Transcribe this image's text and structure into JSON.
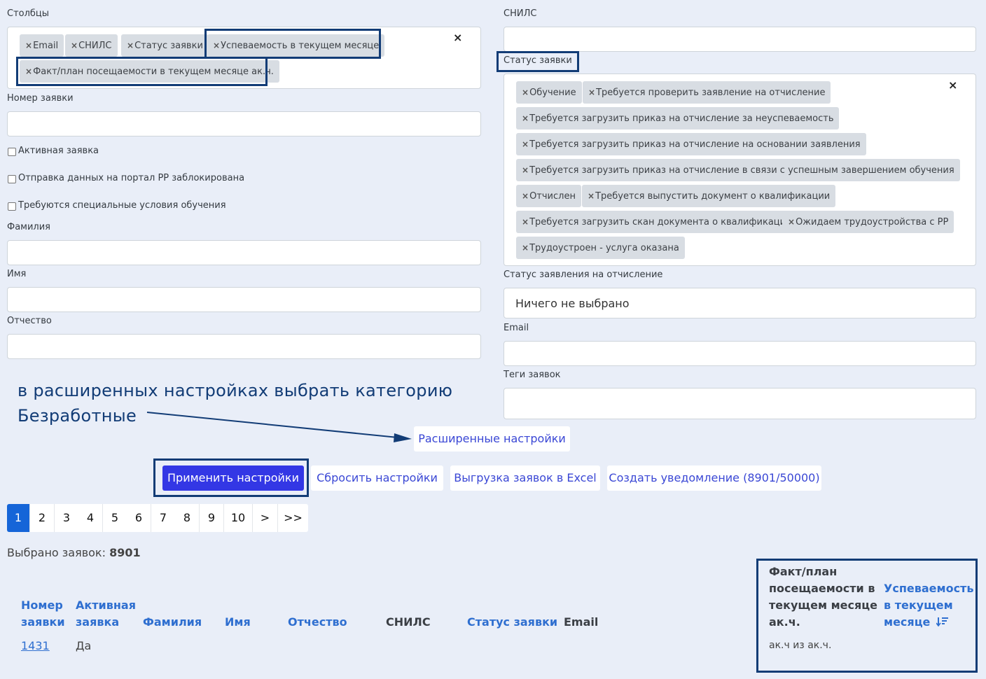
{
  "left": {
    "columns_label": "Столбцы",
    "column_chips": [
      "Email",
      "СНИЛС",
      "Статус заявки",
      "Успеваемость в текущем месяце",
      "Факт/план посещаемости в текущем месяце ак.ч."
    ],
    "clear_symbol": "×",
    "chip_x": "×",
    "order_no_label": "Номер заявки",
    "cb_active": "Активная заявка",
    "cb_blocked": "Отправка данных на портал РР заблокирована",
    "cb_special": "Требуются специальные условия обучения",
    "surname_label": "Фамилия",
    "name_label": "Имя",
    "patronymic_label": "Отчество"
  },
  "right": {
    "snils_label": "СНИЛС",
    "status_label": "Статус заявки",
    "status_chips": [
      "Обучение",
      "Требуется проверить заявление на отчисление",
      "Требуется загрузить приказ на отчисление за неуспеваемость",
      "Требуется загрузить приказ на отчисление на основании заявления",
      "Требуется загрузить приказ на отчисление в связи с успешным завершением обучения",
      "Отчислен",
      "Требуется выпустить документ о квалификации",
      "Требуется загрузить скан документа о квалификации",
      "Ожидаем трудоустройства с РР",
      "Трудоустроен - услуга оказана"
    ],
    "expulsion_status_label": "Статус заявления на отчисление",
    "expulsion_status_value": "Ничего не выбрано",
    "email_label": "Email",
    "tags_label": "Теги заявок"
  },
  "annotation": {
    "line1": "в расширенных настройках выбрать категорию",
    "line2": "Безработные"
  },
  "buttons": {
    "advanced": "Расширенные настройки",
    "apply": "Применить настройки",
    "reset": "Сбросить настройки",
    "export": "Выгрузка заявок в Excel",
    "notify": "Создать уведомление (8901/50000)"
  },
  "pagination": [
    "1",
    "2",
    "3",
    "4",
    "5",
    "6",
    "7",
    "8",
    "9",
    "10",
    ">",
    ">>"
  ],
  "selected": {
    "label": "Выбрано заявок:",
    "count": "8901"
  },
  "table": {
    "headers": {
      "num_1": "Номер",
      "num_2": "заявки",
      "active_1": "Активная",
      "active_2": "заявка",
      "surname": "Фамилия",
      "name": "Имя",
      "patronymic": "Отчество",
      "snils": "СНИЛС",
      "status": "Статус заявки",
      "email": "Email",
      "fact_1": "Факт/план",
      "fact_2": "посещаемости в",
      "fact_3": "текущем месяце",
      "fact_4": "ак.ч.",
      "perf_1": "Успеваемость",
      "perf_2": "в текущем",
      "perf_3": "месяце"
    },
    "row": {
      "num": "1431",
      "active": "Да",
      "fact": "ак.ч из ак.ч."
    }
  },
  "colors": {
    "accent": "#3337e5",
    "page_active": "#1565d8",
    "highlight": "#123c76",
    "background": "#e9eef8"
  }
}
